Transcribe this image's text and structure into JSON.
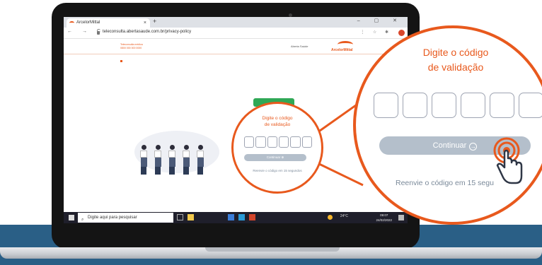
{
  "browser": {
    "tab_title": "ArcelorMittal",
    "tab_close": "×",
    "new_tab": "+",
    "window_controls": "–  ▢  ✕",
    "nav_glyphs": "← → C",
    "url": "teleconsulta.abertasaude.com.br/privacy-policy"
  },
  "site": {
    "header_line1": "Teleconsulta médica",
    "header_line2": "0800 000 000 0000",
    "partner_label": "Aberta Saúde",
    "brand": "ArcelorMittal"
  },
  "validation_small": {
    "title": "Digite o código de validação",
    "code_boxes": 6,
    "button_label": "Continuar ⊕",
    "resend_text": "Reenvie o código em 15 segundos"
  },
  "validation_zoom": {
    "title_line1": "Digite o código",
    "title_line2": "de validação",
    "code_boxes": 6,
    "button_label": "Continuar",
    "button_icon": "arrow-right-circle-icon",
    "resend_text": "Reenvie o código em 15 segu"
  },
  "taskbar": {
    "search_placeholder": "Digite aqui para pesquisar",
    "weather": "24°C",
    "time": "09:07",
    "date": "24/02/2022"
  },
  "colors": {
    "accent": "#e8591d",
    "button_disabled": "#b4bfcb",
    "band": "#2a5f86",
    "green": "#2fa856"
  }
}
